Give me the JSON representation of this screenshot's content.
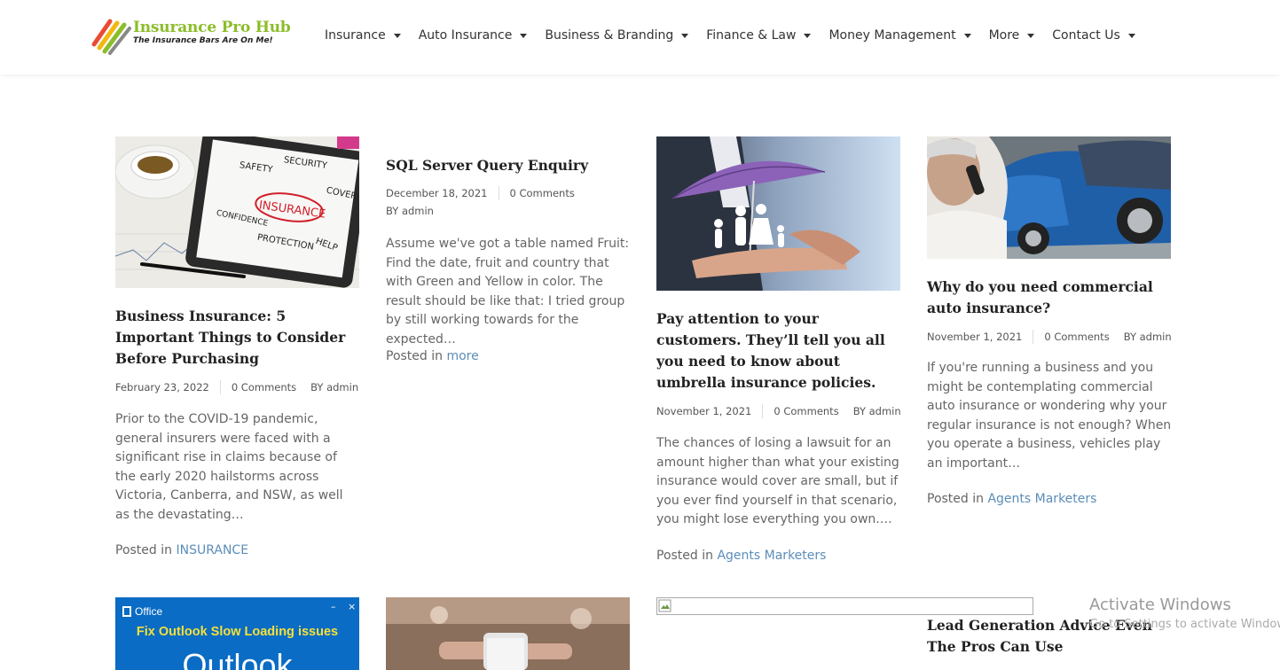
{
  "header": {
    "logo_title": "Insurance Pro Hub",
    "logo_tagline": "The Insurance Bars Are On Me!",
    "nav": [
      {
        "label": "Insurance"
      },
      {
        "label": "Auto Insurance"
      },
      {
        "label": "Business & Branding"
      },
      {
        "label": "Finance & Law"
      },
      {
        "label": "Money Management"
      },
      {
        "label": "More"
      },
      {
        "label": "Contact Us"
      }
    ]
  },
  "posts": [
    {
      "image_text": [
        "SAFETY",
        "SECURITY",
        "INSURANCE",
        "COVERAGE",
        "CONFIDENCE",
        "PROTECTION",
        "HELP"
      ],
      "title": "Business Insurance: 5 Important Things to Consider Before Purchasing",
      "date": "February 23, 2022",
      "comments": "0 Comments",
      "author": "BY admin",
      "excerpt": "Prior to the COVID-19 pandemic, general insurers were faced with a significant rise in claims because of the early 2020 hailstorms across Victoria, Canberra, and NSW, as well as the devastating…",
      "posted_prefix": "Posted in",
      "category": "INSURANCE"
    },
    {
      "title": "SQL Server Query Enquiry",
      "date": "December 18, 2021",
      "comments": "0 Comments",
      "author": "BY admin",
      "excerpt": "Assume we've got a table named Fruit: Find the date, fruit and country that with Green and Yellow in color. The result should be like that: I tried group by still working towards for the expected…",
      "posted_prefix": "Posted in",
      "category": "more"
    },
    {
      "title": "Pay attention to your customers. They’ll tell you all you need to know about umbrella insurance policies.",
      "date": "November 1, 2021",
      "comments": "0 Comments",
      "author": "BY admin",
      "excerpt": "The chances of losing a lawsuit for an amount higher than what your existing insurance would cover are small, but if you ever find yourself in that scenario, you might lose everything you own.…",
      "posted_prefix": "Posted in",
      "category": "Agents Marketers"
    },
    {
      "title": "Why do you need commercial auto insurance?",
      "date": "November 1, 2021",
      "comments": "0 Comments",
      "author": "BY admin",
      "excerpt": "If you're running a business and you might be contemplating commercial auto insurance or wondering why your regular insurance is not enough? When you operate a business, vehicles play an important…",
      "posted_prefix": "Posted in",
      "category": "Agents Marketers"
    }
  ],
  "row2": {
    "outlook_brand": "Office",
    "outlook_headline": "Fix Outlook Slow Loading issues",
    "outlook_word": "Outlook",
    "lead_title": "Lead Generation Advice Even The Pros Can Use"
  },
  "watermark": {
    "title": "Activate Windows",
    "sub": "Go to Settings to activate Windows."
  },
  "colors": {
    "link": "#5b8db8",
    "logo_green": "#8bbd2a",
    "outlook_blue": "#0a6cc4",
    "outlook_yellow": "#f5e03a"
  }
}
